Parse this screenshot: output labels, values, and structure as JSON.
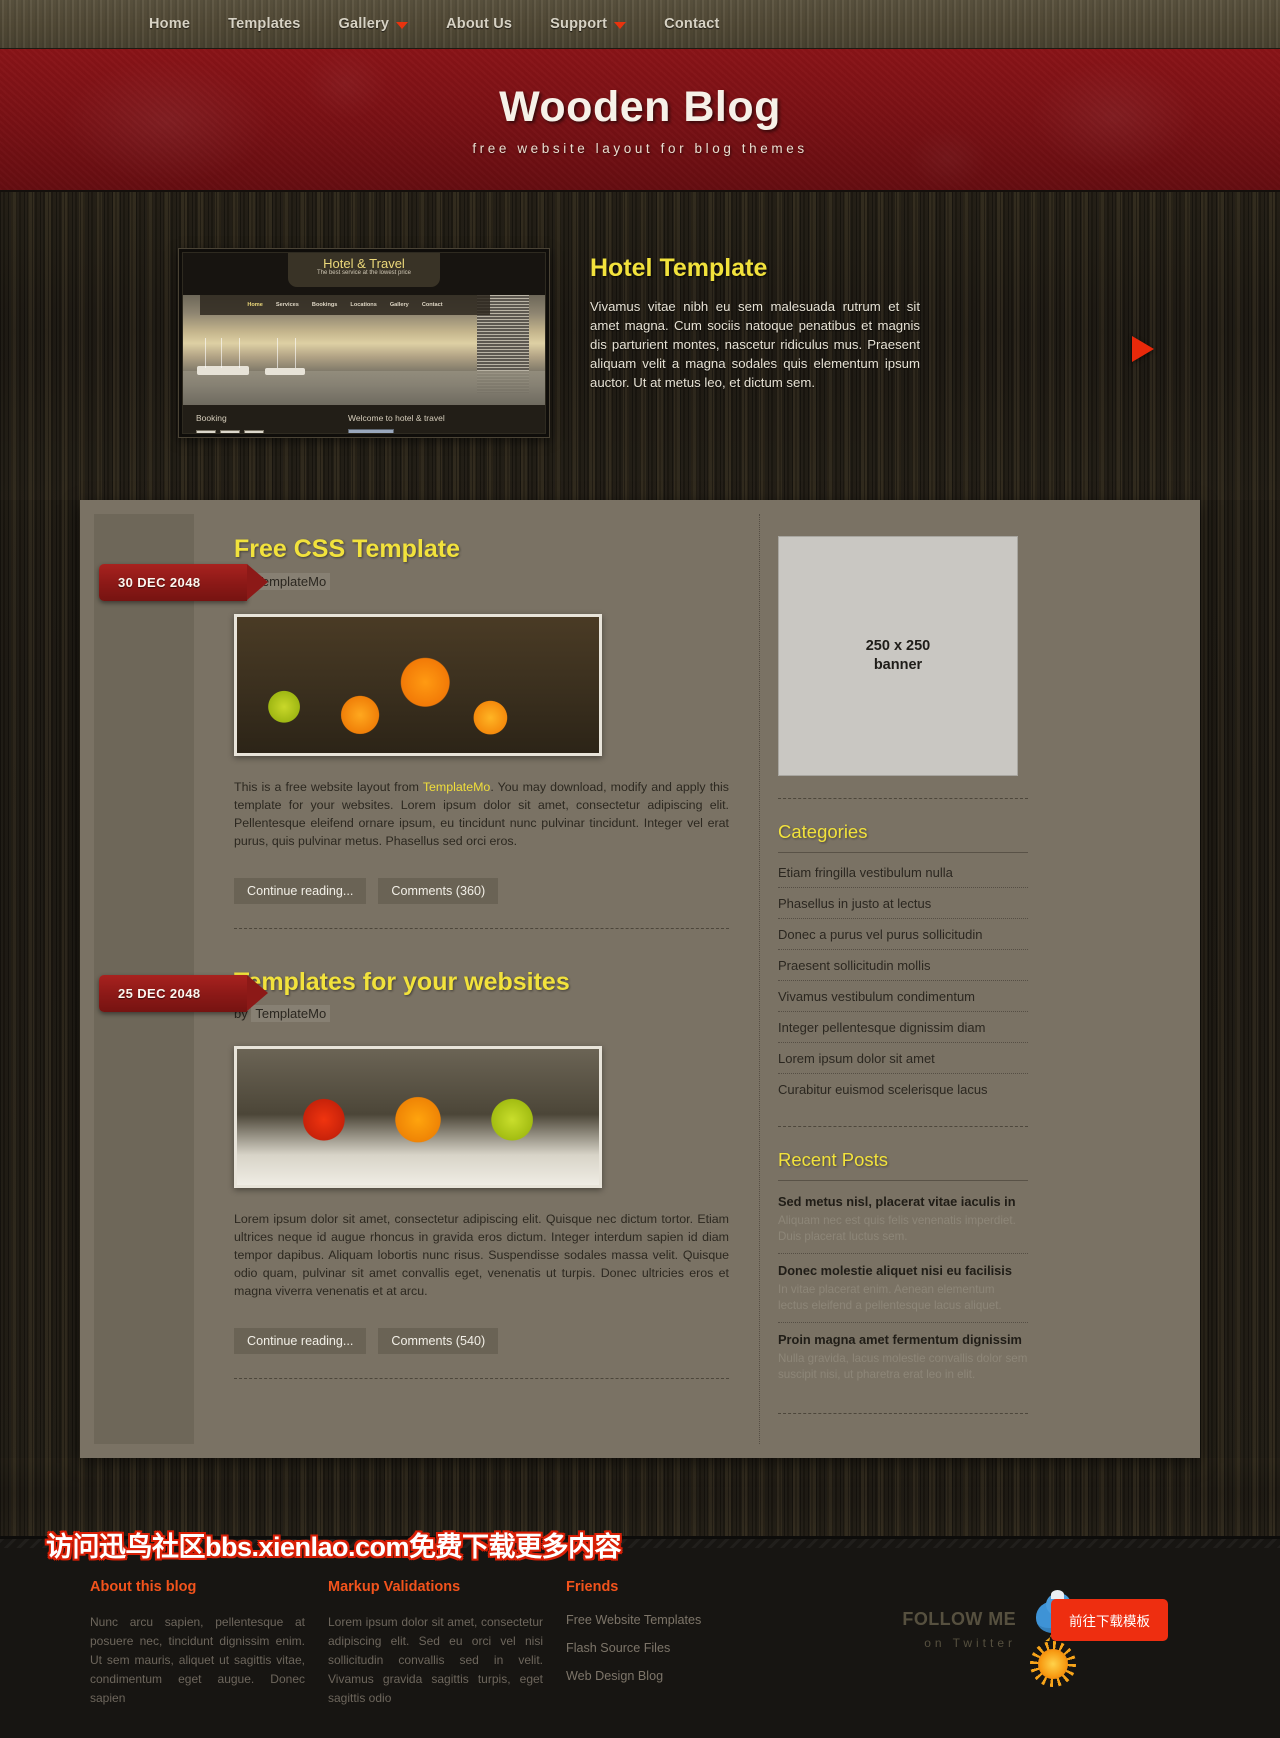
{
  "nav": {
    "items": [
      {
        "label": "Home",
        "caret": false
      },
      {
        "label": "Templates",
        "caret": false
      },
      {
        "label": "Gallery",
        "caret": true
      },
      {
        "label": "About Us",
        "caret": false
      },
      {
        "label": "Support",
        "caret": true
      },
      {
        "label": "Contact",
        "caret": false
      }
    ]
  },
  "header": {
    "title": "Wooden Blog",
    "tagline": "free website layout for blog themes"
  },
  "feature": {
    "title": "Hotel Template",
    "body": "Vivamus vitae nibh eu sem malesuada rutrum et sit amet magna. Cum sociis natoque penatibus et magnis dis parturient montes, nascetur ridiculus mus. Praesent aliquam velit a magna sodales quis elementum ipsum auctor. Ut at metus leo, et dictum sem.",
    "next_label": "next-slide",
    "screenshot": {
      "brand": "Hotel & Travel",
      "slogan": "The best service at the lowest price",
      "nav": [
        "Home",
        "Services",
        "Bookings",
        "Locations",
        "Gallery",
        "Contact"
      ],
      "booking_label": "Booking",
      "welcome_label": "Welcome to hotel & travel"
    }
  },
  "posts": [
    {
      "date": "30 DEC 2048",
      "title": "Free CSS Template",
      "by_prefix": "by",
      "author": "TemplateMo",
      "text_before": "This is a free website layout from ",
      "link": "TemplateMo",
      "text_after": ". You may download, modify and apply this template for your websites. Lorem ipsum dolor sit amet, consectetur adipiscing elit. Pellentesque eleifend ornare ipsum, eu tincidunt nunc pulvinar tincidunt. Integer vel erat purus, quis pulvinar metus. Phasellus sed orci eros.",
      "continue_label": "Continue reading...",
      "comments_label": "Comments (360)",
      "image": "oranges-photo"
    },
    {
      "date": "25 DEC 2048",
      "title": "Templates for your websites",
      "by_prefix": "by",
      "author": "TemplateMo",
      "text_before": "Lorem ipsum dolor sit amet, consectetur adipiscing elit. Quisque nec dictum tortor. Etiam ultrices neque id augue rhoncus in gravida eros dictum. Integer interdum sapien id diam tempor dapibus. Aliquam lobortis nunc risus. Suspendisse sodales massa velit. Quisque odio quam, pulvinar sit amet convallis eget, venenatis ut turpis. Donec ultricies eros et magna viverra venenatis et at arcu.",
      "link": "",
      "text_after": "",
      "continue_label": "Continue reading...",
      "comments_label": "Comments (540)",
      "image": "fruits-photo"
    }
  ],
  "sidebar": {
    "banner_line1": "250 x 250",
    "banner_line2": "banner",
    "categories_title": "Categories",
    "categories": [
      "Etiam fringilla vestibulum nulla",
      "Phasellus in justo at lectus",
      "Donec a purus vel purus sollicitudin",
      "Praesent sollicitudin mollis",
      "Vivamus vestibulum condimentum",
      "Integer pellentesque dignissim diam",
      "Lorem ipsum dolor sit amet",
      "Curabitur euismod scelerisque lacus"
    ],
    "recent_title": "Recent Posts",
    "recent_posts": [
      {
        "title": "Sed metus nisl, placerat vitae iaculis in",
        "desc": "Aliquam nec est quis felis venenatis imperdiet. Duis placerat luctus sem."
      },
      {
        "title": "Donec molestie aliquet nisi eu facilisis",
        "desc": "In vitae placerat enim. Aenean elementum lectus eleifend a pellentesque lacus aliquet."
      },
      {
        "title": "Proin magna amet fermentum dignissim",
        "desc": "Nulla gravida, lacus molestie convallis dolor sem suscipit nisi, ut pharetra erat leo in elit."
      }
    ]
  },
  "footer": {
    "about_title": "About this blog",
    "about_text": "Nunc arcu sapien, pellentesque at posuere nec, tincidunt dignissim enim. Ut sem mauris, aliquet ut sagittis vitae, condimentum eget augue. Donec sapien",
    "markup_title": "Markup Validations",
    "markup_text": "Lorem ipsum dolor sit amet, consectetur adipiscing elit. Sed eu orci vel nisi sollicitudin convallis sed in velit. Vivamus gravida sagittis turpis, eget sagittis odio",
    "friends_title": "Friends",
    "friends_links": [
      "Free Website Templates",
      "Flash Source Files",
      "Web Design Blog"
    ],
    "follow_big": "FOLLOW ME",
    "follow_small": "on Twitter",
    "download_label": "前往下载模板"
  },
  "watermark": "访问迅鸟社区bbs.xienlao.com免费下载更多内容",
  "colors": {
    "accent_yellow": "#f2e23c",
    "header_red": "#7c1216",
    "ribbon_red": "#8c1917",
    "footer_orange": "#f2531c",
    "arrow_red": "#e8290a"
  }
}
